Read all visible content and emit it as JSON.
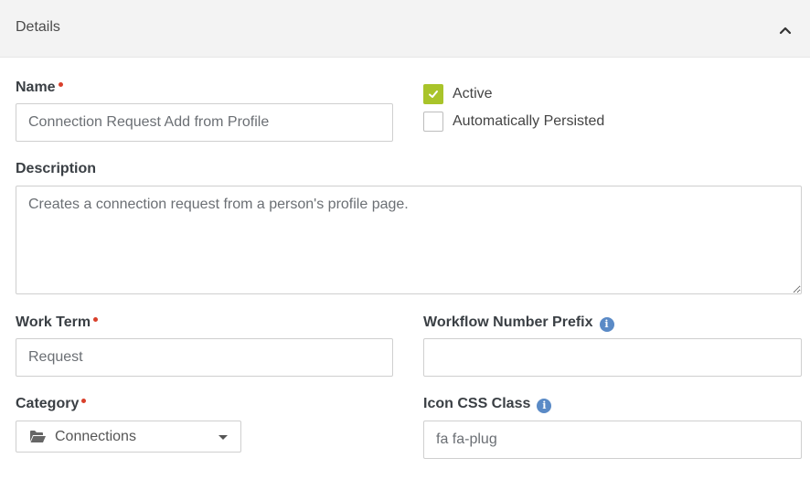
{
  "panel": {
    "title": "Details"
  },
  "fields": {
    "name": {
      "label": "Name",
      "value": "Connection Request Add from Profile"
    },
    "active": {
      "label": "Active",
      "checked": true
    },
    "persisted": {
      "label": "Automatically Persisted",
      "checked": false
    },
    "description": {
      "label": "Description",
      "value": "Creates a connection request from a person's profile page."
    },
    "work_term": {
      "label": "Work Term",
      "value": "Request"
    },
    "workflow_prefix": {
      "label": "Workflow Number Prefix",
      "value": ""
    },
    "category": {
      "label": "Category",
      "value": "Connections"
    },
    "icon_css": {
      "label": "Icon CSS Class",
      "value": "fa fa-plug"
    }
  },
  "icons": {
    "collapse": "chevron-up-icon",
    "required": "required-dot-icon",
    "info": "info-icon",
    "folder": "folder-open-icon",
    "dropdown": "caret-down-icon"
  },
  "colors": {
    "accent": "#a9c42a",
    "required": "#d9402b",
    "info": "#5a8ac6"
  },
  "info_glyph": "i"
}
